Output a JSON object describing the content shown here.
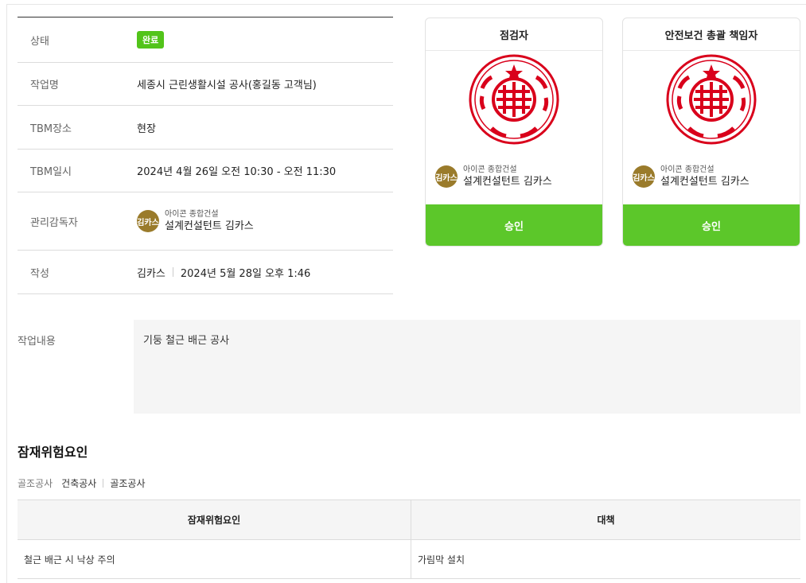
{
  "info": {
    "status": {
      "label": "상태",
      "value": "완료"
    },
    "work_name": {
      "label": "작업명",
      "value": "세종시 근린생활시설 공사(홍길동 고객님)"
    },
    "tbm_place": {
      "label": "TBM장소",
      "value": "현장"
    },
    "tbm_datetime": {
      "label": "TBM일시",
      "value": "2024년 4월 26일 오전 10:30 - 오전 11:30"
    },
    "supervisor": {
      "label": "관리감독자",
      "avatar": "김카스",
      "company": "아이콘 종합건설",
      "role": "설계컨설턴트 김카스"
    },
    "author": {
      "label": "작성",
      "name": "김카스",
      "date": "2024년 5월 28일 오후 1:46"
    }
  },
  "approvals": [
    {
      "title": "점검자",
      "seal_icon": "official-seal-icon",
      "avatar": "김카스",
      "company": "아이콘 종합건설",
      "role": "설계컨설턴트 김카스",
      "button": "승인"
    },
    {
      "title": "안전보건 총괄 책임자",
      "seal_icon": "official-seal-icon",
      "avatar": "김카스",
      "company": "아이콘 종합건설",
      "role": "설계컨설턴트 김카스",
      "button": "승인"
    }
  ],
  "work_content": {
    "label": "작업내용",
    "value": "기둥 철근 배근 공사"
  },
  "hazards": {
    "title": "잠재위험요인",
    "breadcrumb": [
      "골조공사",
      "건축공사",
      "골조공사"
    ],
    "columns": [
      "잠재위험요인",
      "대책"
    ],
    "rows": [
      {
        "hazard": "철근 배근 시 낙상 주의",
        "measure": "가림막 설치"
      }
    ]
  },
  "colors": {
    "accent_green": "#5cc72a",
    "badge_green": "#52c41a",
    "avatar_gold": "#9a7b2b",
    "seal_red": "#d9001b"
  }
}
